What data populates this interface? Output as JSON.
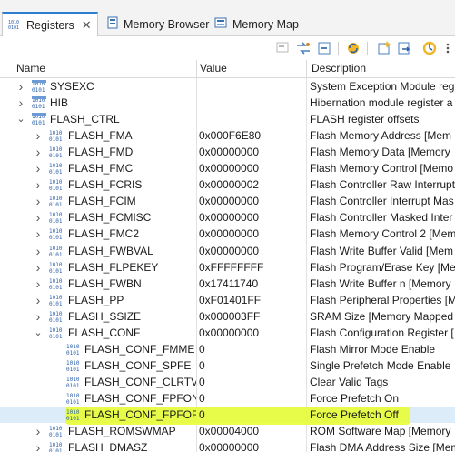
{
  "tabs": [
    {
      "label": "Registers",
      "active": true,
      "icon": "registers-icon"
    },
    {
      "label": "Memory Browser",
      "active": false,
      "icon": "memory-browser-icon"
    },
    {
      "label": "Memory Map",
      "active": false,
      "icon": "memory-map-icon"
    }
  ],
  "columns": {
    "name": "Name",
    "value": "Value",
    "description": "Description"
  },
  "colors": {
    "highlight": "#e8ff2a",
    "selection": "#dcecf9",
    "tab_accent": "#2c7fd0"
  },
  "rows": [
    {
      "name": "SYSEXC",
      "value": "",
      "desc": "System Exception Module regi",
      "level": 1,
      "expand": "collapsed",
      "icon": "register-group-icon"
    },
    {
      "name": "HIB",
      "value": "",
      "desc": "Hibernation module register a",
      "level": 1,
      "expand": "collapsed",
      "icon": "register-group-icon"
    },
    {
      "name": "FLASH_CTRL",
      "value": "",
      "desc": "FLASH register offsets",
      "level": 1,
      "expand": "expanded",
      "icon": "register-group-icon"
    },
    {
      "name": "FLASH_FMA",
      "value": "0x000F6E80",
      "desc": "Flash Memory Address [Mem",
      "level": 2,
      "expand": "collapsed",
      "icon": "register-icon"
    },
    {
      "name": "FLASH_FMD",
      "value": "0x00000000",
      "desc": "Flash Memory Data [Memory",
      "level": 2,
      "expand": "collapsed",
      "icon": "register-icon"
    },
    {
      "name": "FLASH_FMC",
      "value": "0x00000000",
      "desc": "Flash Memory Control [Memo",
      "level": 2,
      "expand": "collapsed",
      "icon": "register-icon"
    },
    {
      "name": "FLASH_FCRIS",
      "value": "0x00000002",
      "desc": "Flash Controller Raw Interrupt",
      "level": 2,
      "expand": "collapsed",
      "icon": "register-icon"
    },
    {
      "name": "FLASH_FCIM",
      "value": "0x00000000",
      "desc": "Flash Controller Interrupt Mas",
      "level": 2,
      "expand": "collapsed",
      "icon": "register-icon"
    },
    {
      "name": "FLASH_FCMISC",
      "value": "0x00000000",
      "desc": "Flash Controller Masked Inter",
      "level": 2,
      "expand": "collapsed",
      "icon": "register-icon"
    },
    {
      "name": "FLASH_FMC2",
      "value": "0x00000000",
      "desc": "Flash Memory Control 2 [Mem",
      "level": 2,
      "expand": "collapsed",
      "icon": "register-icon"
    },
    {
      "name": "FLASH_FWBVAL",
      "value": "0x00000000",
      "desc": "Flash Write Buffer Valid [Mem",
      "level": 2,
      "expand": "collapsed",
      "icon": "register-icon"
    },
    {
      "name": "FLASH_FLPEKEY",
      "value": "0xFFFFFFFF",
      "desc": "Flash Program/Erase Key [Me",
      "level": 2,
      "expand": "collapsed",
      "icon": "register-icon"
    },
    {
      "name": "FLASH_FWBN",
      "value": "0x17411740",
      "desc": "Flash Write Buffer n [Memory",
      "level": 2,
      "expand": "collapsed",
      "icon": "register-icon"
    },
    {
      "name": "FLASH_PP",
      "value": "0xF01401FF",
      "desc": "Flash Peripheral Properties [M",
      "level": 2,
      "expand": "collapsed",
      "icon": "register-icon"
    },
    {
      "name": "FLASH_SSIZE",
      "value": "0x000003FF",
      "desc": "SRAM Size [Memory Mapped",
      "level": 2,
      "expand": "collapsed",
      "icon": "register-icon"
    },
    {
      "name": "FLASH_CONF",
      "value": "0x00000000",
      "desc": "Flash Configuration Register [",
      "level": 2,
      "expand": "expanded",
      "icon": "register-icon"
    },
    {
      "name": "FLASH_CONF_FMME",
      "value": "0",
      "desc": "Flash Mirror Mode Enable",
      "level": 3,
      "expand": "none",
      "icon": "bitfield-icon"
    },
    {
      "name": "FLASH_CONF_SPFE",
      "value": "0",
      "desc": "Single Prefetch Mode Enable",
      "level": 3,
      "expand": "none",
      "icon": "bitfield-icon"
    },
    {
      "name": "FLASH_CONF_CLRTV",
      "value": "0",
      "desc": "Clear Valid Tags",
      "level": 3,
      "expand": "none",
      "icon": "bitfield-icon"
    },
    {
      "name": "FLASH_CONF_FPFON",
      "value": "0",
      "desc": "Force Prefetch On",
      "level": 3,
      "expand": "none",
      "icon": "bitfield-icon"
    },
    {
      "name": "FLASH_CONF_FPFOFF",
      "value": "0",
      "desc": "Force Prefetch Off",
      "level": 3,
      "expand": "none",
      "icon": "bitfield-icon",
      "selected": true,
      "highlighted": true
    },
    {
      "name": "FLASH_ROMSWMAP",
      "value": "0x00004000",
      "desc": "ROM Software Map [Memory",
      "level": 2,
      "expand": "collapsed",
      "icon": "register-icon"
    },
    {
      "name": "FLASH_DMASZ",
      "value": "0x00000000",
      "desc": "Flash DMA Address Size [Mem",
      "level": 2,
      "expand": "collapsed",
      "icon": "register-icon"
    }
  ]
}
